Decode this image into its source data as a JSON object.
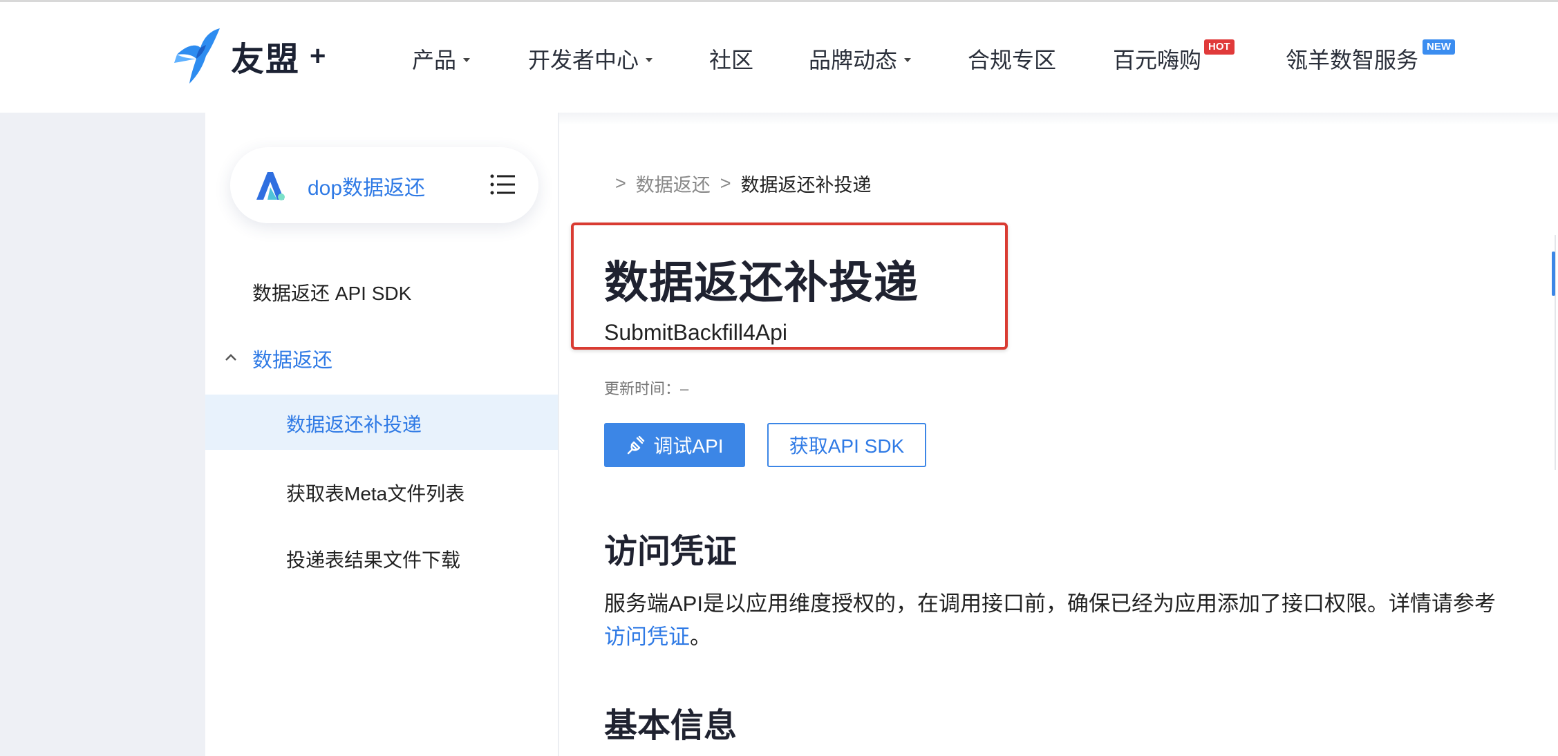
{
  "header": {
    "logo_text": "友盟",
    "logo_plus": "+",
    "nav": [
      {
        "label": "产品"
      },
      {
        "label": "开发者中心"
      },
      {
        "label": "社区"
      },
      {
        "label": "品牌动态"
      },
      {
        "label": "合规专区"
      },
      {
        "label": "百元嗨购",
        "badge": "HOT"
      },
      {
        "label": "瓴羊数智服务",
        "badge": "NEW"
      }
    ]
  },
  "sidebar": {
    "product_name": "dop数据返还",
    "items": [
      {
        "label": "数据返还 API SDK"
      },
      {
        "label": "数据返还"
      },
      {
        "label": "数据返还补投递"
      },
      {
        "label": "获取表Meta文件列表"
      },
      {
        "label": "投递表结果文件下载"
      }
    ]
  },
  "main": {
    "breadcrumb": [
      ">",
      "数据返还",
      ">",
      "数据返还补投递"
    ],
    "title": "数据返还补投递",
    "api_name": "SubmitBackfill4Api",
    "update_time": "更新时间：–",
    "debug_button": "调试API",
    "sdk_button": "获取API SDK",
    "section_access": "访问凭证",
    "access_text_1": "服务端API是以应用维度授权的，在调用接口前，确保已经为应用添加了接口权限。详情请参考",
    "access_link": "访问凭证",
    "access_text_2": "。",
    "section_basic": "基本信息"
  },
  "colors": {
    "accent": "#3c86e6",
    "highlight_border": "#d93b32",
    "hot_badge": "#e03a3a",
    "new_badge": "#3b8df0"
  }
}
